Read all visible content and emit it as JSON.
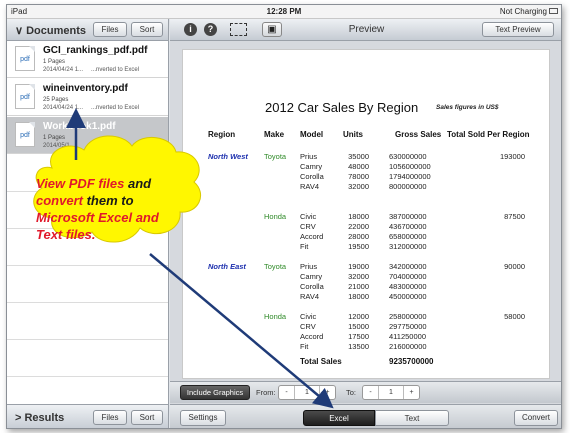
{
  "status_bar": {
    "device": "iPad",
    "time": "12:28 PM",
    "battery_text": "Not Charging"
  },
  "left_panel": {
    "title": "Documents",
    "files_button": "Files",
    "sort_button": "Sort",
    "files": [
      {
        "name": "GCI_rankings_pdf.pdf",
        "pages": "1 Pages",
        "date": "2014/04/24 1...",
        "status": "...nverted to Excel"
      },
      {
        "name": "wineinventory.pdf",
        "pages": "25 Pages",
        "date": "2014/04/24 1...",
        "status": "...nverted to Excel"
      },
      {
        "name": "Workbook1.pdf",
        "pages": "1 Pages",
        "date": "2014/05/1",
        "status": ""
      }
    ],
    "footer_title": "Results",
    "footer_files_button": "Files",
    "footer_sort_button": "Sort",
    "icon_label": "pdf"
  },
  "preview": {
    "title": "Preview",
    "text_preview_button": "Text Preview",
    "info_icon": "i",
    "help_icon": "?",
    "doc": {
      "title": "2012 Car Sales By Region",
      "subtitle": "Sales figures in US$",
      "headers": [
        "Region",
        "Make",
        "Model",
        "Units",
        "Gross Sales",
        "Total Sold Per Region"
      ],
      "groups": [
        {
          "region": "North West",
          "make": "Toyota",
          "total": "193000",
          "rows": [
            [
              "Prius",
              "35000",
              "630000000"
            ],
            [
              "Camry",
              "48000",
              "1056000000"
            ],
            [
              "Corolla",
              "78000",
              "1794000000"
            ],
            [
              "RAV4",
              "32000",
              "800000000"
            ]
          ]
        },
        {
          "region": "",
          "make": "Honda",
          "total": "87500",
          "rows": [
            [
              "Civic",
              "18000",
              "387000000"
            ],
            [
              "CRV",
              "22000",
              "436700000"
            ],
            [
              "Accord",
              "28000",
              "658000000"
            ],
            [
              "Fit",
              "19500",
              "312000000"
            ]
          ]
        },
        {
          "region": "North East",
          "make": "Toyota",
          "total": "90000",
          "rows": [
            [
              "Prius",
              "19000",
              "342000000"
            ],
            [
              "Camry",
              "32000",
              "704000000"
            ],
            [
              "Corolla",
              "21000",
              "483000000"
            ],
            [
              "RAV4",
              "18000",
              "450000000"
            ]
          ]
        },
        {
          "region": "",
          "make": "Honda",
          "total": "58000",
          "rows": [
            [
              "Civic",
              "12000",
              "258000000"
            ],
            [
              "CRV",
              "15000",
              "297750000"
            ],
            [
              "Accord",
              "17500",
              "411250000"
            ],
            [
              "Fit",
              "13500",
              "216000000"
            ]
          ]
        }
      ],
      "total_label": "Total Sales",
      "total_value": "9235700000"
    },
    "bottom_bar": {
      "include_graphics": "Include Graphics",
      "from_label": "From:",
      "from_value": "1",
      "to_label": "To:",
      "to_value": "1",
      "minus": "-",
      "plus": "+"
    },
    "footer": {
      "settings": "Settings",
      "excel": "Excel",
      "text": "Text",
      "convert": "Convert"
    }
  },
  "callout": {
    "part1": "View PDF files",
    "part2": " and ",
    "part3": "convert",
    "part4": " them to ",
    "part5": "Microsoft Excel and Text files."
  },
  "colors": {
    "arrow": "#1f3b78",
    "callout_fill": "#fff700",
    "callout_text": "#e0192b",
    "region_text": "#1c2fae",
    "make_text": "#2f8a28"
  }
}
